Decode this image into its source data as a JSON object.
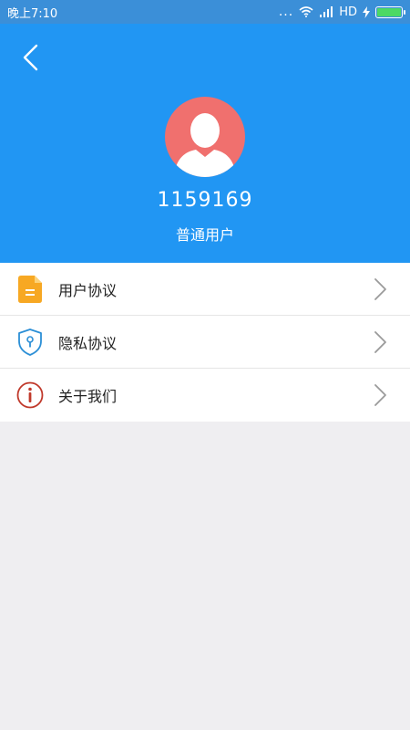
{
  "status_bar": {
    "time": "晚上7:10",
    "signal_dots": "...",
    "network": "HD"
  },
  "header": {
    "back_icon": "chevron-left-icon",
    "avatar_icon": "user-avatar-icon",
    "user_id": "1159169",
    "user_role": "普通用户",
    "background_color": "#2196f3",
    "avatar_color": "#f0706e"
  },
  "menu": {
    "items": [
      {
        "label": "用户协议",
        "icon": "document-icon",
        "icon_color": "#f7a823"
      },
      {
        "label": "隐私协议",
        "icon": "shield-lock-icon",
        "icon_color": "#2c8fd6"
      },
      {
        "label": "关于我们",
        "icon": "info-circle-icon",
        "icon_color": "#c0392b"
      }
    ]
  }
}
